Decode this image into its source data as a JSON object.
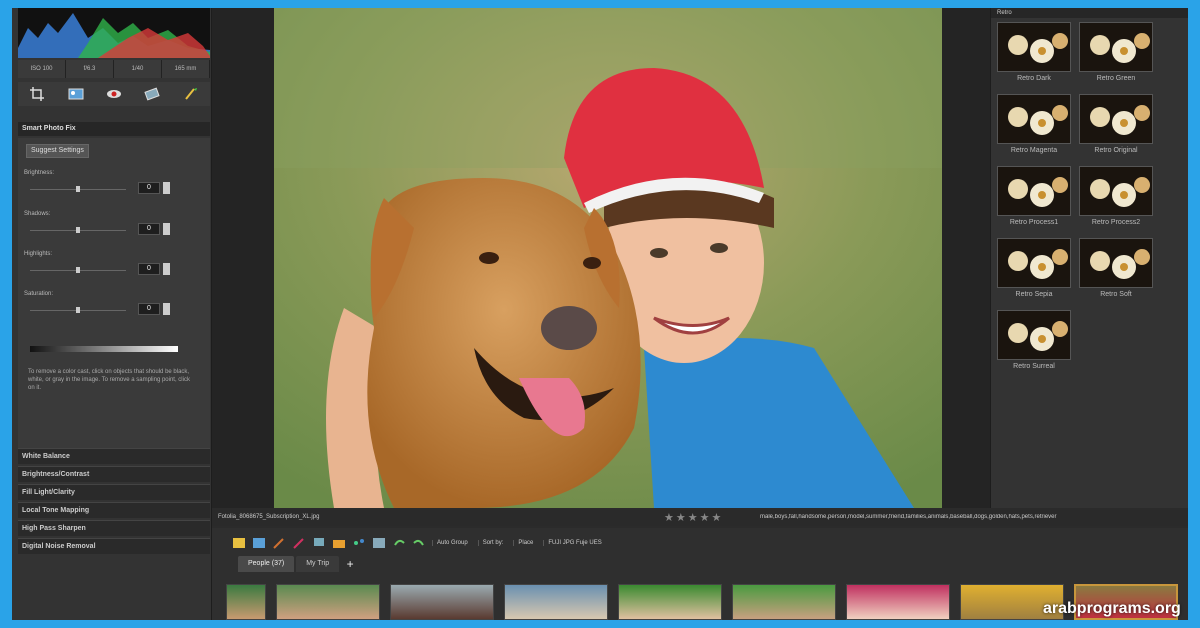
{
  "histogram": {
    "colors": [
      "#3a7fd8",
      "#2fb34a",
      "#d83a3a"
    ]
  },
  "exif": [
    "ISO 100",
    "f/6.3",
    "1/40",
    "165 mm"
  ],
  "tools": [
    "crop-icon",
    "straighten-icon",
    "red-eye-icon",
    "retouch-icon",
    "brush-icon"
  ],
  "smart_photo_fix": {
    "title": "Smart Photo Fix",
    "suggest_label": "Suggest Settings",
    "sliders": [
      {
        "label": "Brightness:",
        "value": "0",
        "level": 0.5
      },
      {
        "label": "Shadows:",
        "value": "0",
        "level": 0.5
      },
      {
        "label": "Highlights:",
        "value": "0",
        "level": 0.5
      },
      {
        "label": "Saturation:",
        "value": "0",
        "level": 0.5
      }
    ],
    "help": "To remove a color cast, click on objects that should be black, white, or gray in the image. To remove a sampling point, click on it."
  },
  "accordion": [
    "White Balance",
    "Brightness/Contrast",
    "Fill Light/Clarity",
    "Local Tone Mapping",
    "High Pass Sharpen",
    "Digital Noise Removal"
  ],
  "presets": {
    "title": "Retro",
    "items": [
      "Retro Dark",
      "Retro Green",
      "Retro Magenta",
      "Retro Original",
      "Retro Process1",
      "Retro Process2",
      "Retro Sepia",
      "Retro Soft",
      "Retro Surreal"
    ]
  },
  "info": {
    "filename": "Fotolia_8068675_Subscription_XL.jpg",
    "stars": "★★★★★",
    "tags": "male,boys,fall,handsome,person,model,summer,friend,families,animals,baseball,dogs,golden,hats,pets,retriever"
  },
  "filmstrip": {
    "auto_group": "Auto Group",
    "sort_by": "Sort by:",
    "sort_value": "Place",
    "filter": "FUJI JPG Fuje UES",
    "tabs": [
      "People (37)",
      "My Trip"
    ],
    "add": "+"
  },
  "watermark": "arabprograms.org"
}
